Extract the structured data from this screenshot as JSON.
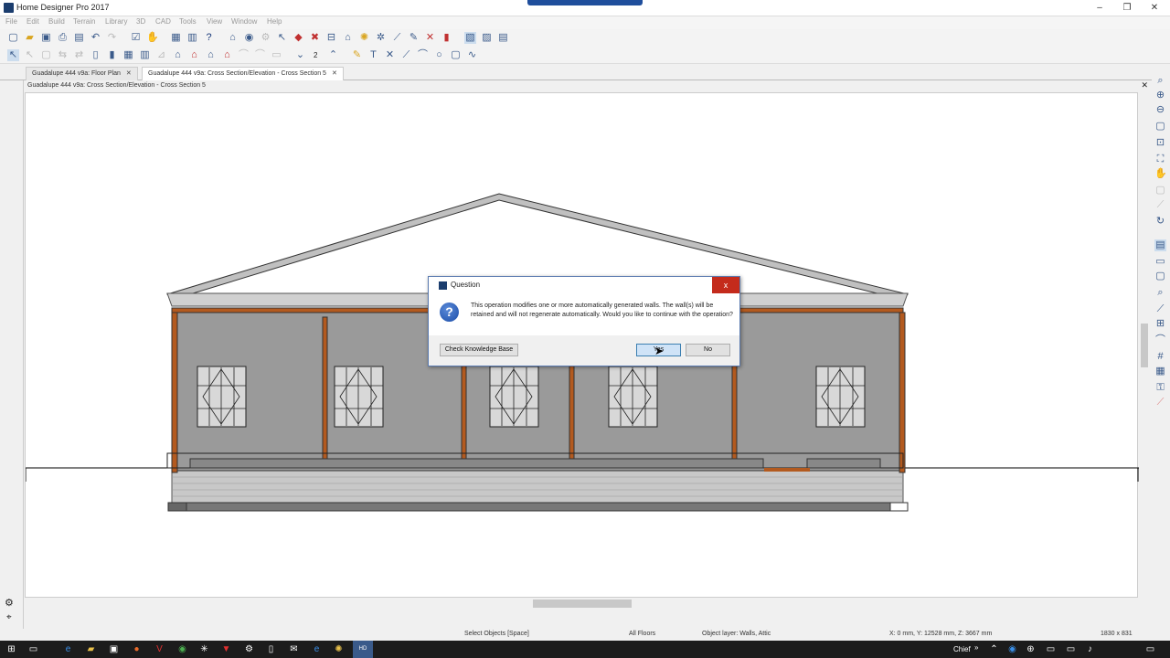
{
  "window": {
    "title": "Home Designer Pro 2017",
    "minimize": "‒",
    "restore": "❐",
    "close": "✕"
  },
  "menu": [
    "File",
    "Edit",
    "Build",
    "Terrain",
    "Library",
    "3D",
    "CAD",
    "Tools",
    "View",
    "Window",
    "Help"
  ],
  "toolbar": {
    "layer_number": "2"
  },
  "tabs": [
    {
      "label": "Guadalupe 444 v9a: Floor Plan",
      "close": "✕",
      "active": false
    },
    {
      "label": "Guadalupe 444 v9a: Cross Section/Elevation - Cross Section 5",
      "close": "✕",
      "active": true
    }
  ],
  "document": {
    "header": "Guadalupe 444 v9a: Cross Section/Elevation - Cross Section 5",
    "close": "✕"
  },
  "dialog": {
    "title": "Question",
    "close": "x",
    "icon": "?",
    "message": "This operation modifies one or more automatically generated walls. The wall(s) will be retained and will not regenerate automatically. Would you like to continue with the operation?",
    "check_kb": "Check Knowledge Base",
    "yes": "Yes",
    "no": "No"
  },
  "status": {
    "mode": "Select Objects [Space]",
    "floors": "All Floors",
    "layer": "Object layer: Walls,  Attic",
    "coords": "X: 0 mm, Y: 12528 mm, Z: 3667 mm",
    "size": "1830 x 831"
  },
  "taskbar": {
    "user": "Chief",
    "chevron": "»"
  },
  "colors": {
    "wall": "#9a9a9a",
    "trim": "#b35a1f",
    "foundation": "#c8c8c8",
    "roof": "#c0c0c0",
    "accent": "#1f4e9c"
  }
}
